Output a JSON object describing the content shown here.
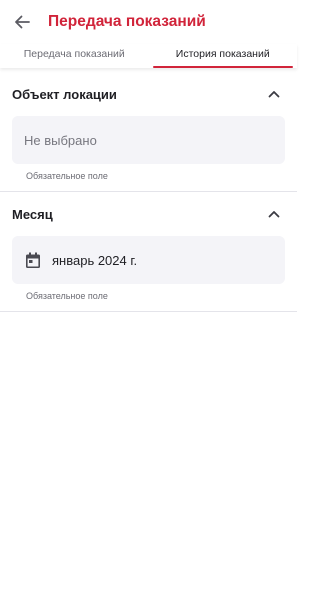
{
  "header": {
    "title": "Передача показаний",
    "back_icon": "arrow-left-icon"
  },
  "tabs": [
    {
      "label": "Передача показаний",
      "active": false
    },
    {
      "label": "История показаний",
      "active": true
    }
  ],
  "sections": {
    "location": {
      "title": "Объект локации",
      "placeholder": "Не выбрано",
      "hint": "Обязательное поле",
      "expanded": true
    },
    "month": {
      "title": "Месяц",
      "value": "январь 2024 г.",
      "hint": "Обязательное поле",
      "expanded": true,
      "icon": "calendar-icon"
    }
  },
  "colors": {
    "accent": "#d1243a",
    "field_bg": "#f4f4f8",
    "text": "#1f1f24",
    "muted": "#6c6c74"
  }
}
